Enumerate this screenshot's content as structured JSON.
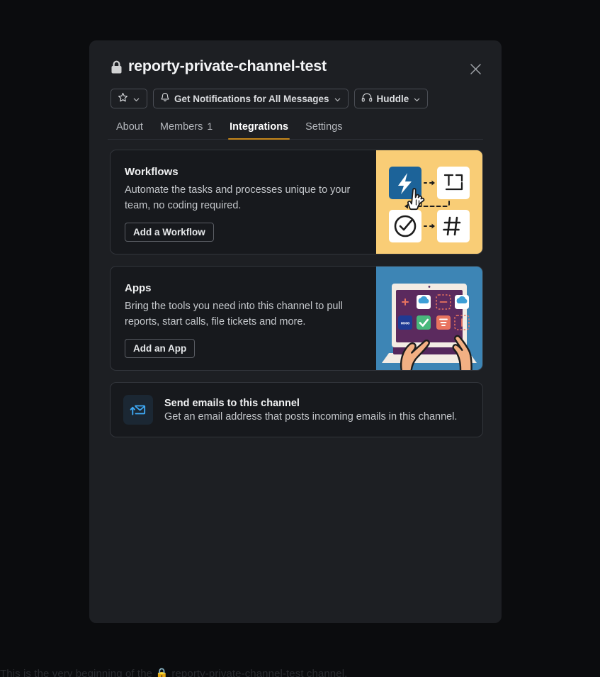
{
  "background": {
    "page_text": "This is the very beginning of the 🔒 reporty-private-channel-test channel."
  },
  "modal": {
    "header": {
      "lock_icon": "lock-icon",
      "channel_name": "reporty-private-channel-test",
      "close_label": "Close",
      "close_icon": "close-icon"
    },
    "actions": [
      {
        "id": "star",
        "label": "",
        "icon": "star-icon",
        "chevron": "chevron-down-icon"
      },
      {
        "id": "notifications",
        "label": "Get Notifications for All Messages",
        "icon": "bell-icon",
        "chevron": "chevron-down-icon"
      },
      {
        "id": "huddle",
        "label": "Huddle",
        "icon": "headphones-icon",
        "chevron": "chevron-down-icon"
      }
    ],
    "tabs": [
      {
        "id": "about",
        "label": "About",
        "count": "",
        "active": false
      },
      {
        "id": "members",
        "label": "Members",
        "count": "1",
        "active": false
      },
      {
        "id": "integrations",
        "label": "Integrations",
        "count": "",
        "active": true
      },
      {
        "id": "settings",
        "label": "Settings",
        "count": "",
        "active": false
      }
    ],
    "active_tab_underline_color": "#c8881b",
    "cards": [
      {
        "id": "workflows",
        "title": "Workflows",
        "description": "Automate the tasks and processes unique to your team, no coding required.",
        "button_label": "Add a Workflow",
        "art": "workflows-illustration",
        "art_bg_color": "#f9cd76"
      },
      {
        "id": "apps",
        "title": "Apps",
        "description": "Bring the tools you need into this channel to pull reports, start calls, file tickets and more.",
        "button_label": "Add an App",
        "art": "apps-illustration",
        "art_bg_color": "#3d85b5"
      }
    ],
    "email_row": {
      "icon": "email-forward-icon",
      "title": "Send emails to this channel",
      "description": "Get an email address that posts incoming emails in this channel."
    }
  }
}
